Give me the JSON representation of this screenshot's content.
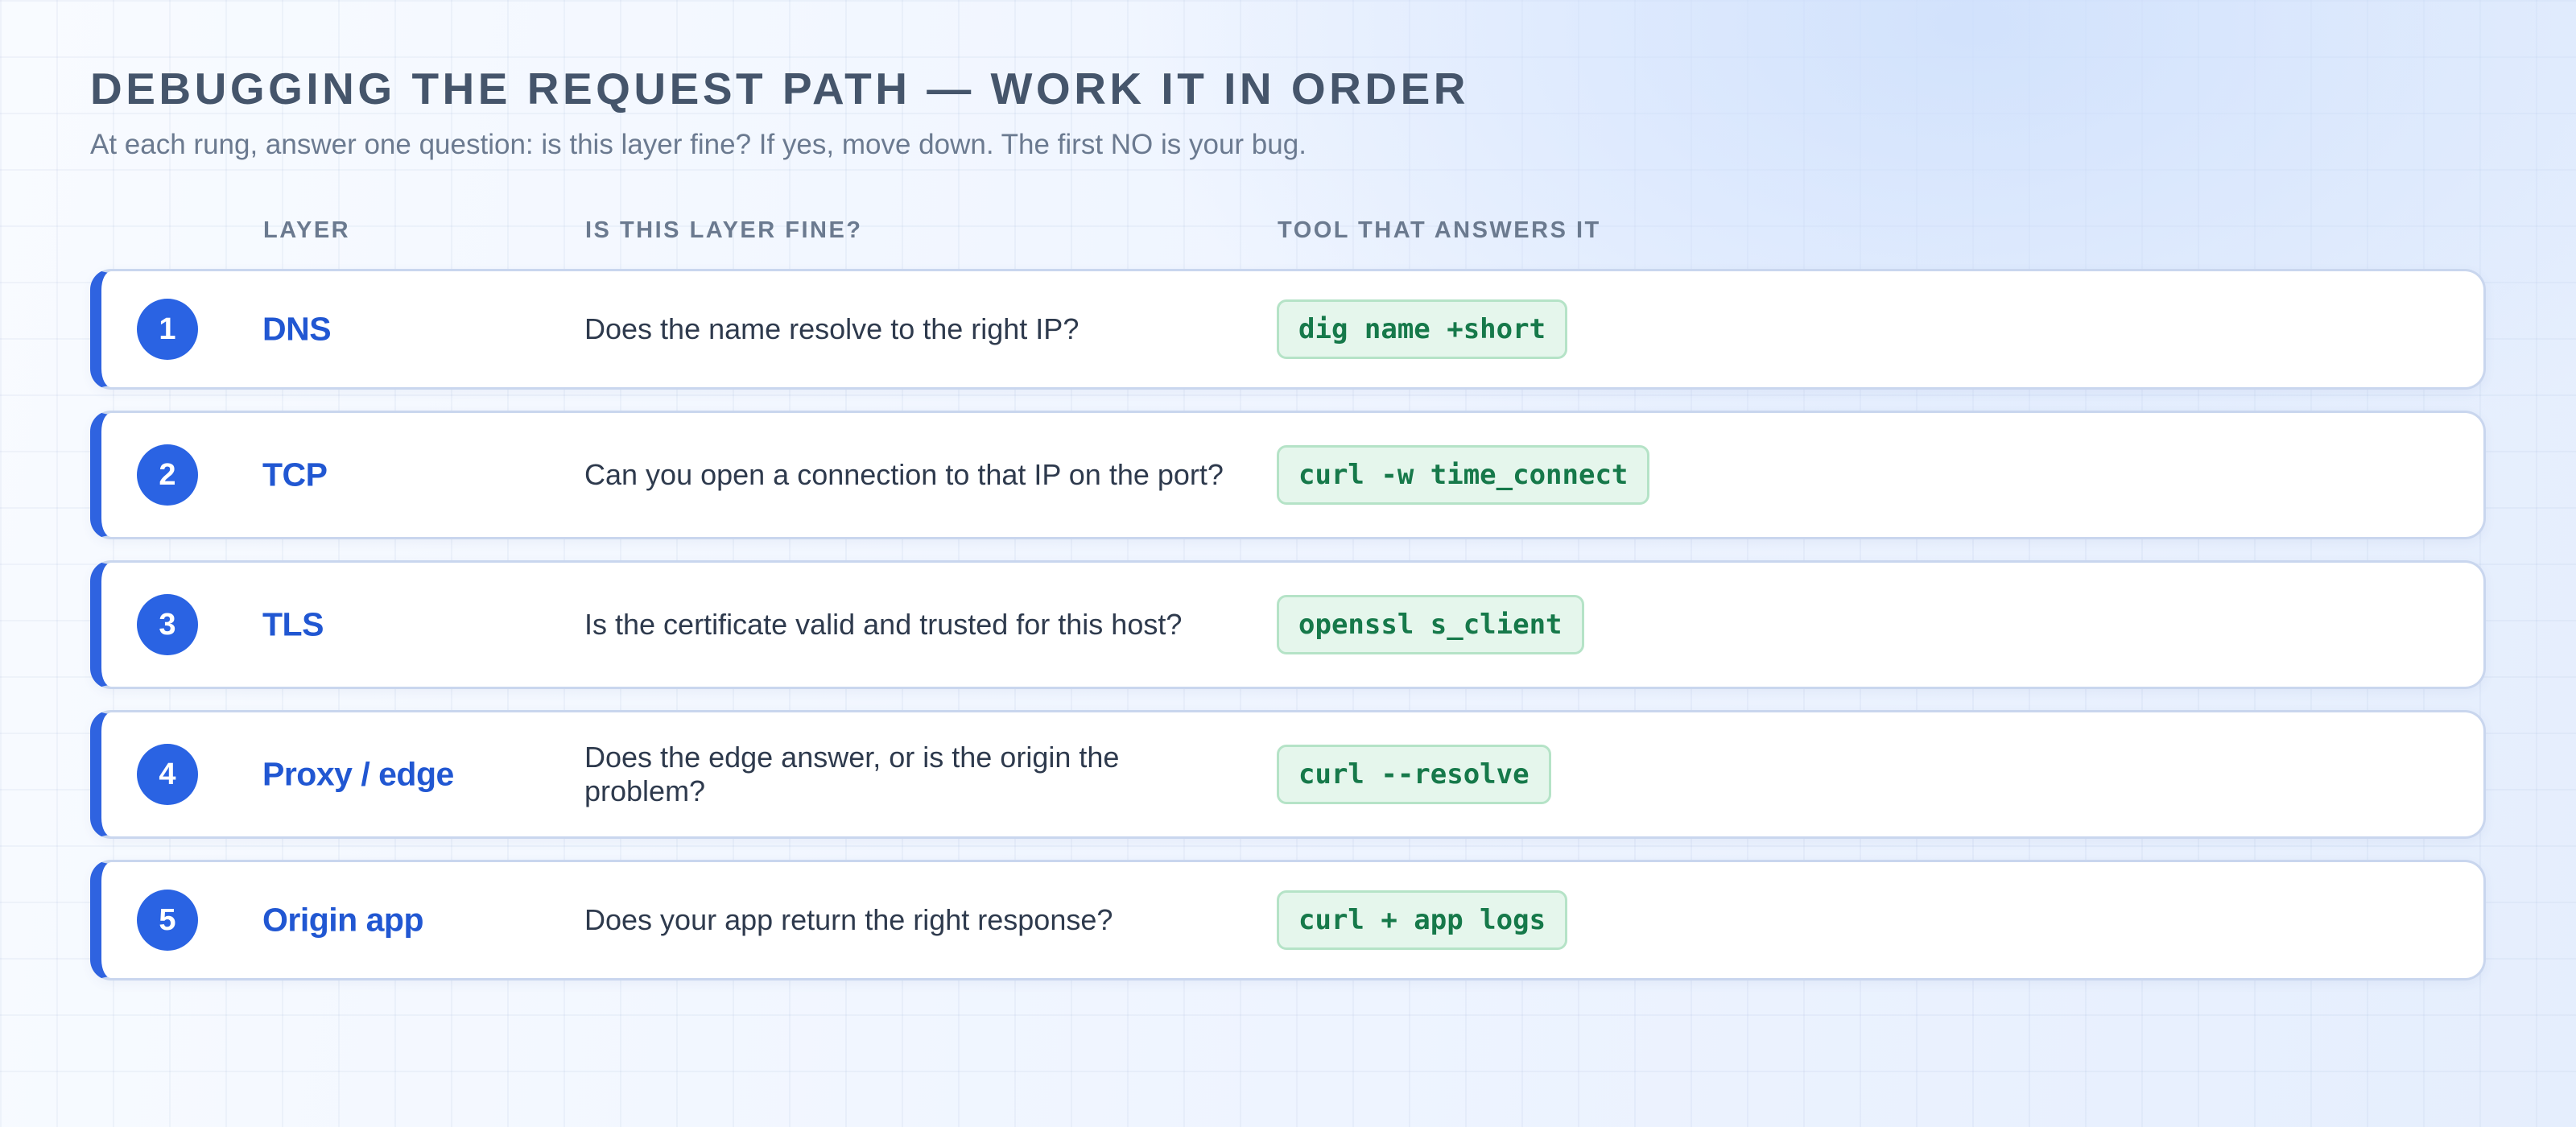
{
  "header": {
    "title": "DEBUGGING THE REQUEST PATH — WORK IT IN ORDER",
    "subtitle": "At each rung, answer one question: is this layer fine? If yes, move down. The first NO is your bug."
  },
  "columns": {
    "layer": "LAYER",
    "question": "IS THIS LAYER FINE?",
    "tool": "TOOL THAT ANSWERS IT"
  },
  "rows": [
    {
      "number": "1",
      "layer": "DNS",
      "question": "Does the name resolve to the right IP?",
      "tool": "dig name +short"
    },
    {
      "number": "2",
      "layer": "TCP",
      "question": "Can you open a connection to that IP on the port?",
      "tool": "curl -w time_connect"
    },
    {
      "number": "3",
      "layer": "TLS",
      "question": "Is the certificate valid and trusted for this host?",
      "tool": "openssl s_client"
    },
    {
      "number": "4",
      "layer": "Proxy / edge",
      "question": "Does the edge answer, or is the origin the problem?",
      "tool": "curl --resolve"
    },
    {
      "number": "5",
      "layer": "Origin app",
      "question": "Does your app return the right response?",
      "tool": "curl + app logs"
    }
  ],
  "colors": {
    "accent": "#2a63e3",
    "layer_text": "#2157d2",
    "tool_text": "#16794a",
    "tool_bg": "#e5f6ec"
  }
}
